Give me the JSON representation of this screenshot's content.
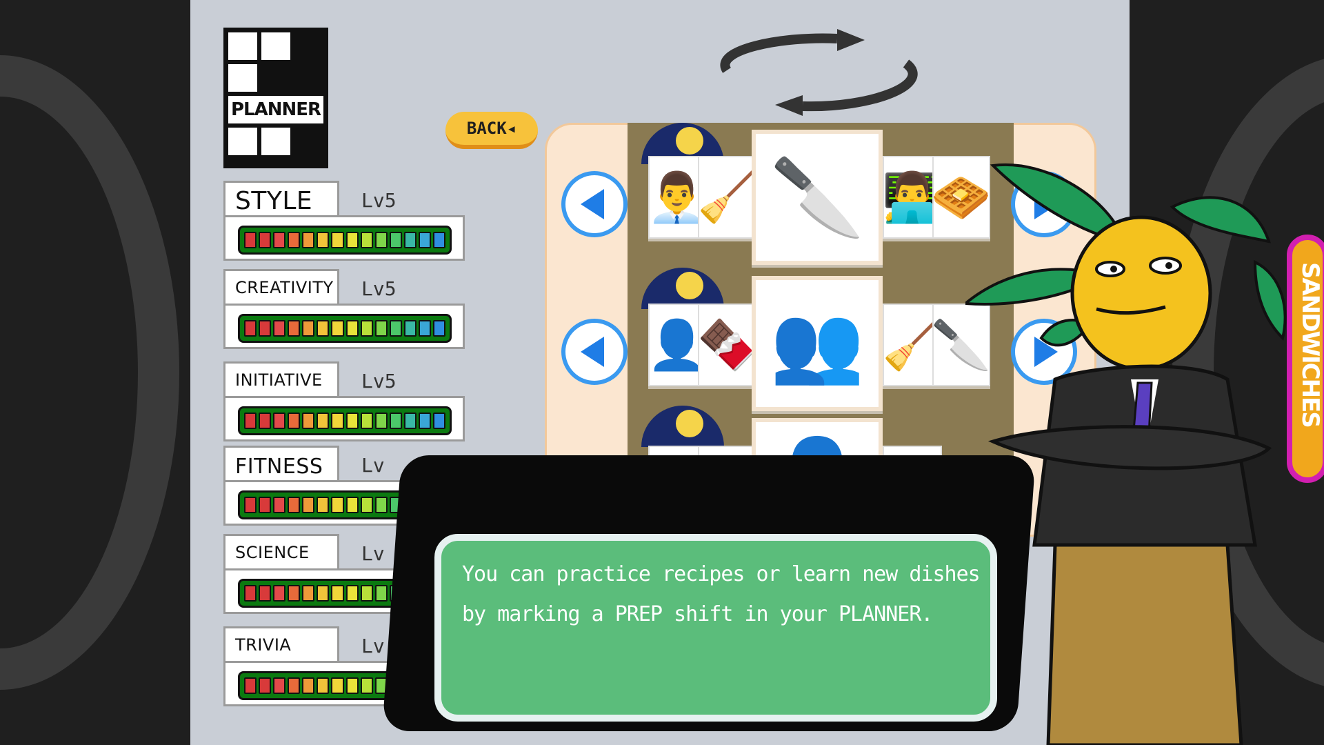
{
  "planner": {
    "label": "PLANNER"
  },
  "back_button": {
    "label": "BACK◂"
  },
  "stats": [
    {
      "name": "STYLE",
      "level": "Lv5"
    },
    {
      "name": "CREATIVITY",
      "level": "Lv5"
    },
    {
      "name": "INITIATIVE",
      "level": "Lv5"
    },
    {
      "name": "FITNESS",
      "level": "Lv"
    },
    {
      "name": "SCIENCE",
      "level": "Lv"
    },
    {
      "name": "TRIVIA",
      "level": "Lv"
    }
  ],
  "bar_segment_colors": [
    "#d83a3a",
    "#d83a3a",
    "#e24a4a",
    "#e86a3a",
    "#ef9a3a",
    "#f1c43a",
    "#f1d63a",
    "#e8e43a",
    "#b8e03a",
    "#7fd64a",
    "#4cc76a",
    "#3ab8a6",
    "#3aa6d6",
    "#2f8fe0"
  ],
  "shifts": [
    {
      "icons": [
        "👨‍💼",
        "🧹",
        "🔪",
        "👨‍💻",
        "🧇"
      ]
    },
    {
      "icons": [
        "👤",
        "🍫",
        "👥",
        "🧹",
        "🔪"
      ]
    },
    {
      "icons": [
        "🪽",
        "🔪",
        "👤",
        "🧇",
        ""
      ]
    }
  ],
  "dialog": {
    "line1": "You can practice recipes or learn new dishes",
    "line2": "by marking a PREP shift in your PLANNER."
  },
  "side_logo": {
    "text": "SANDWICHES"
  },
  "colors": {
    "panel": "#c9ced6",
    "dialog_bg": "#5bbd7b",
    "back_button": "#f7c23b",
    "arrow_blue": "#1f7de6"
  }
}
